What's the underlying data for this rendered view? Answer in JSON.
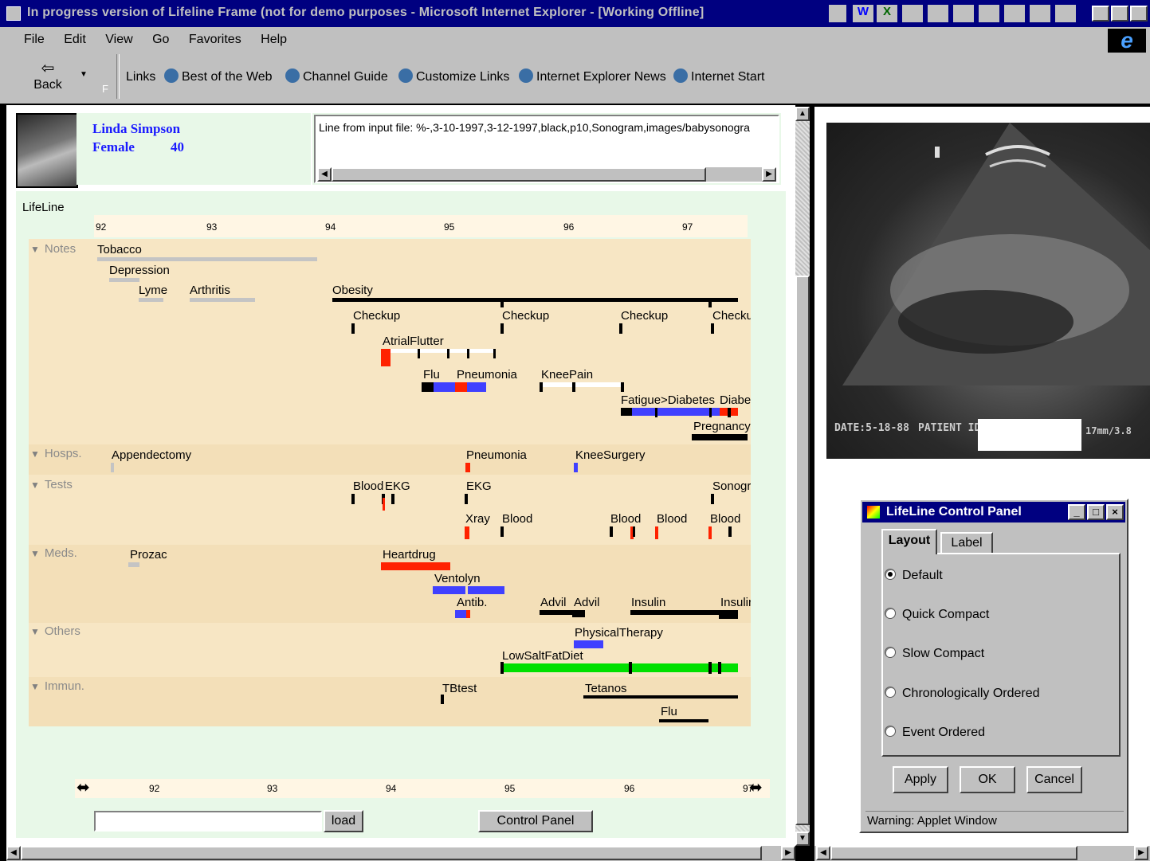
{
  "window": {
    "title": "In progress version of Lifeline Frame (not for demo purposes - Microsoft Internet Explorer - [Working Offline]"
  },
  "menu": [
    "File",
    "Edit",
    "View",
    "Go",
    "Favorites",
    "Help"
  ],
  "toolbar": {
    "back_label": "Back",
    "forward_stub": "F",
    "links_label": "Links",
    "links": [
      "Best of the Web",
      "Channel Guide",
      "Customize Links",
      "Internet Explorer News",
      "Internet Start"
    ]
  },
  "patient": {
    "name": "Linda Simpson",
    "sex": "Female",
    "age": "40"
  },
  "input_line": "Line from input file:  %-,3-10-1997,3-12-1997,black,p10,Sonogram,images/babysonogra",
  "lifeline": {
    "title": "LifeLine",
    "years": [
      "92",
      "93",
      "94",
      "95",
      "96",
      "97"
    ],
    "categories": [
      "Notes",
      "Hosps.",
      "Tests",
      "Meds.",
      "Others",
      "Immun."
    ]
  },
  "labels": {
    "tobacco": "Tobacco",
    "depression": "Depression",
    "lyme": "Lyme",
    "arthritis": "Arthritis",
    "obesity": "Obesity",
    "checkup1": "Checkup",
    "checkup2": "Checkup",
    "checkup3": "Checkup",
    "checkup4": "Checku",
    "atrial": "AtrialFlutter",
    "flu": "Flu",
    "pneumonia": "Pneumonia",
    "kneepain": "KneePain",
    "fatigue": "Fatigue>Diabetes",
    "diabe": "Diabe",
    "pregnancy": "Pregnancy",
    "appendectomy": "Appendectomy",
    "hosp_pneumonia": "Pneumonia",
    "kneesurgery": "KneeSurgery",
    "blood1": "Blood",
    "ekg1": "EKG",
    "ekg2": "EKG",
    "sonogr": "Sonogr",
    "xray": "Xray",
    "blood2": "Blood",
    "blood3": "Blood",
    "blood4": "Blood",
    "blood5": "Blood",
    "prozac": "Prozac",
    "heartdrug": "Heartdrug",
    "ventolyn": "Ventolyn",
    "antib": "Antib.",
    "advil1": "Advil",
    "advil2": "Advil",
    "insulin1": "Insulin",
    "insulin2": "Insulir",
    "physical": "PhysicalTherapy",
    "lowsalt": "LowSaltFatDiet",
    "tbtest": "TBtest",
    "tetanos": "Tetanos",
    "imm_flu": "Flu"
  },
  "bottom": {
    "years": [
      "92",
      "93",
      "94",
      "95",
      "96",
      "97"
    ],
    "load_label": "load",
    "control_panel_label": "Control Panel",
    "input_value": ""
  },
  "image": {
    "date_text": "DATE:5-18-88",
    "patient_text": "PATIENT ID",
    "scale_text": "17mm/3.8"
  },
  "control_panel": {
    "title": "LifeLine Control Panel",
    "tabs": [
      "Layout",
      "Label"
    ],
    "options": [
      "Default",
      "Quick Compact",
      "Slow Compact",
      "Chronologically Ordered",
      "Event Ordered"
    ],
    "selected": "Default",
    "buttons": [
      "Apply",
      "OK",
      "Cancel"
    ],
    "warning": "Warning: Applet Window"
  },
  "colors": {
    "red": "#ff2200",
    "blue": "#4040ff",
    "green": "#00e000",
    "gray": "#c4c4c4",
    "track": "#f7e6c4",
    "panel": "#e8f8e8"
  }
}
